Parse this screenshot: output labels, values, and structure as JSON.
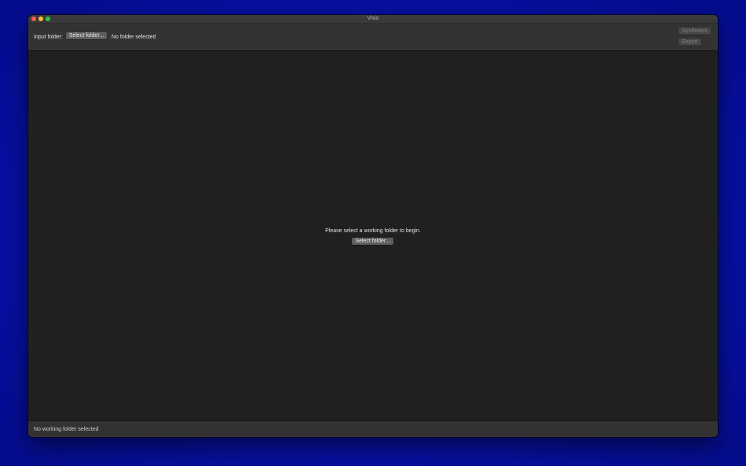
{
  "window": {
    "title": "Visio"
  },
  "toolbar": {
    "input_folder_label": "Input folder:",
    "select_folder_label": "Select folder...",
    "folder_status": "No folder selected",
    "synthetics_label": "Synthetics",
    "export_label": "Export"
  },
  "main": {
    "prompt": "Please select a working folder to begin.",
    "select_folder_label": "Select folder..."
  },
  "statusbar": {
    "text": "No working folder selected"
  },
  "colors": {
    "desktop": "#0710a6",
    "window_bg": "#202020",
    "toolbar_bg": "#333333",
    "button_bg": "#5f5f5f",
    "button_disabled_bg": "#474747"
  }
}
